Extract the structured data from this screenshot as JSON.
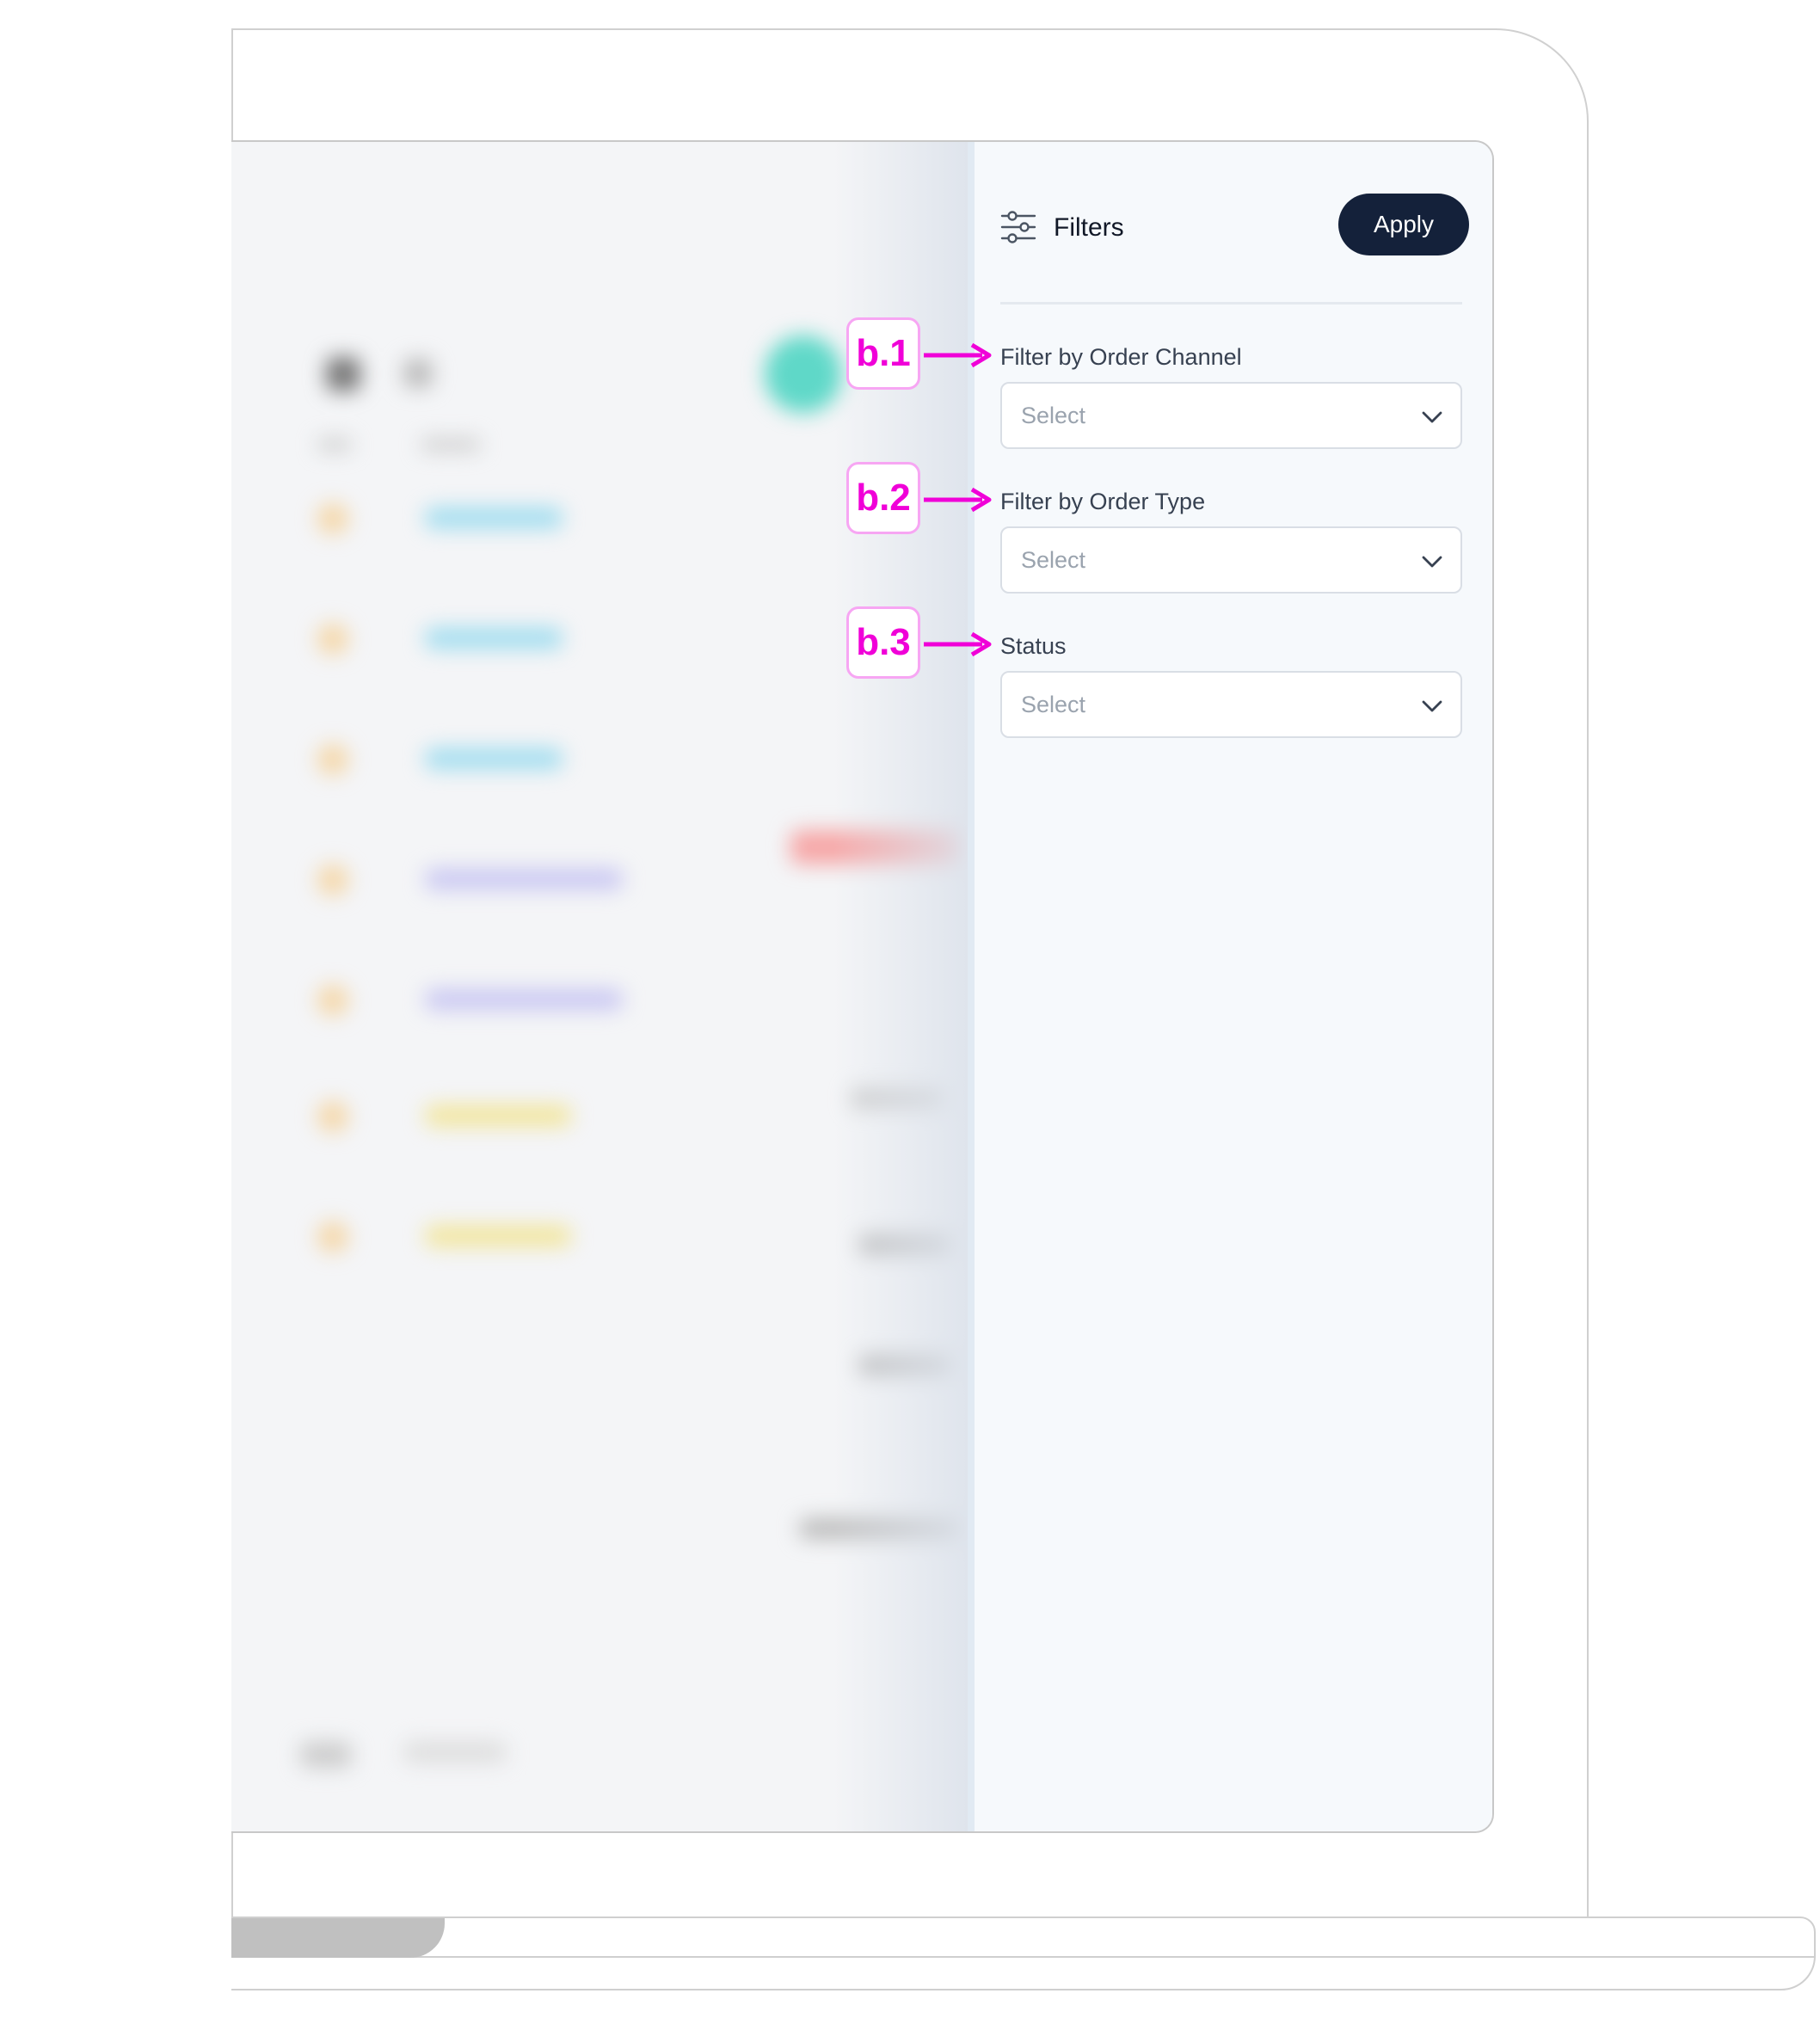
{
  "drawer": {
    "title": "Filters",
    "apply_label": "Apply",
    "fields": [
      {
        "label": "Filter by Order Channel",
        "placeholder": "Select"
      },
      {
        "label": "Filter by Order Type",
        "placeholder": "Select"
      },
      {
        "label": "Status",
        "placeholder": "Select"
      }
    ]
  },
  "annotations": [
    "b.1",
    "b.2",
    "b.3"
  ],
  "colors": {
    "accent_button": "#14213a",
    "annotation": "#f000d8",
    "drawer_bg": "#f6f9fc"
  },
  "icons": {
    "filters": "sliders-icon",
    "dropdown": "chevron-down-icon",
    "annotation_arrow": "arrow-right-icon"
  }
}
